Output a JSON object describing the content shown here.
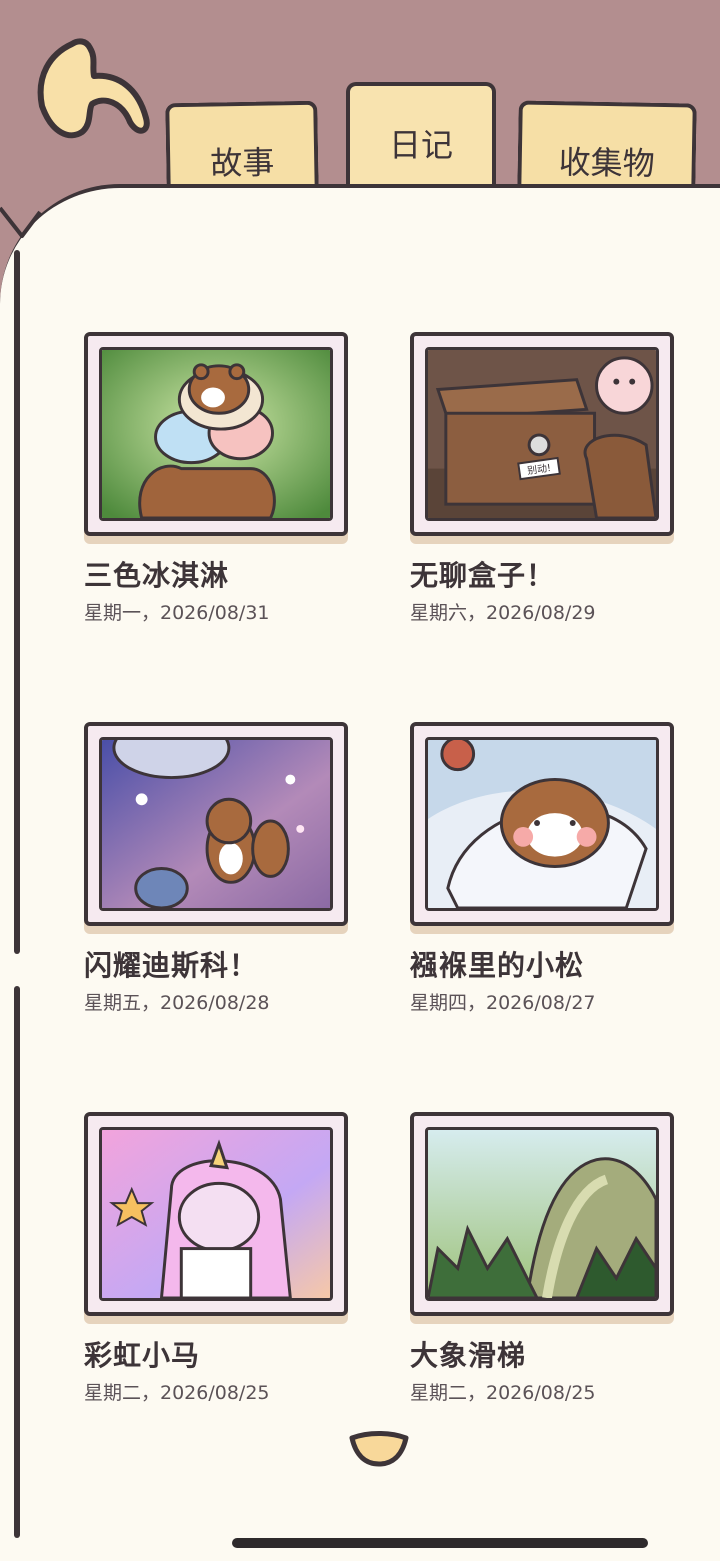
{
  "tabs": [
    {
      "label": "故事"
    },
    {
      "label": "日记"
    },
    {
      "label": "收集物"
    }
  ],
  "active_tab": "日记",
  "entries": [
    {
      "title": "三色冰淇淋",
      "date": "星期一，2026/08/31"
    },
    {
      "title": "无聊盒子！",
      "date": "星期六，2026/08/29"
    },
    {
      "title": "闪耀迪斯科！",
      "date": "星期五，2026/08/28"
    },
    {
      "title": "襁褓里的小松",
      "date": "星期四，2026/08/27"
    },
    {
      "title": "彩虹小马",
      "date": "星期二，2026/08/25"
    },
    {
      "title": "大象滑梯",
      "date": "星期二，2026/08/25"
    }
  ],
  "box_sticker": "别动!",
  "colors": {
    "background": "#b38e8f",
    "page": "#fdfaf2",
    "tab": "#f6dfa6",
    "outline": "#3d3438"
  }
}
